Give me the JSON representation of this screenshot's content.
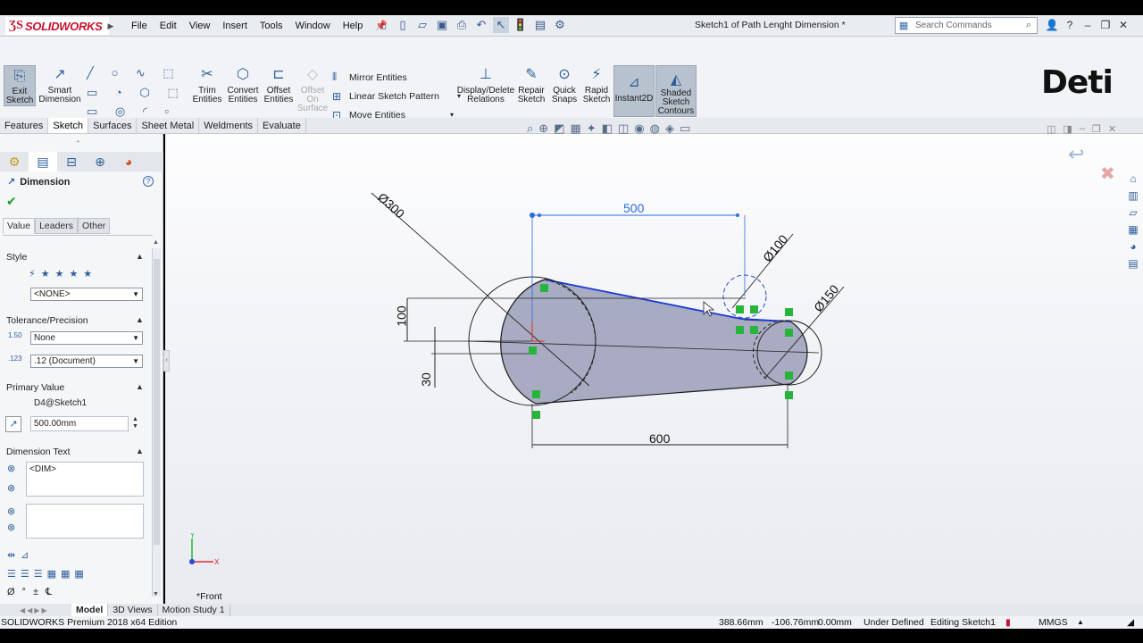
{
  "app": {
    "brand": "SOLIDWORKS",
    "doc_title": "Sketch1 of Path Lenght Dimension *"
  },
  "menu": [
    "File",
    "Edit",
    "View",
    "Insert",
    "Tools",
    "Window",
    "Help"
  ],
  "search": {
    "placeholder": "Search Commands"
  },
  "ribbon": {
    "exit_sketch": "Exit\nSketch",
    "smart_dimension": "Smart\nDimension",
    "trim": "Trim\nEntities",
    "convert": "Convert\nEntities",
    "offset": "Offset\nEntities",
    "offset_surface": "Offset\nOn\nSurface",
    "mirror": "Mirror Entities",
    "linear_pattern": "Linear Sketch Pattern",
    "move": "Move Entities",
    "display_relations": "Display/Delete\nRelations",
    "repair": "Repair\nSketch",
    "quick_snaps": "Quick\nSnaps",
    "rapid": "Rapid\nSketch",
    "instant2d": "Instant2D",
    "shaded": "Shaded\nSketch\nContours"
  },
  "brand_logo": {
    "text": "Deti"
  },
  "command_tabs": [
    "Features",
    "Sketch",
    "Surfaces",
    "Sheet Metal",
    "Weldments",
    "Evaluate"
  ],
  "property_manager": {
    "title": "Dimension",
    "subtabs": [
      "Value",
      "Leaders",
      "Other"
    ],
    "style_label": "Style",
    "style_value": "<NONE>",
    "tolerance_label": "Tolerance/Precision",
    "tolerance_value": "None",
    "precision_value": ".12 (Document)",
    "primary_label": "Primary Value",
    "primary_name": "D4@Sketch1",
    "primary_value": "500.00mm",
    "dim_text_label": "Dimension Text",
    "dim_text_value": "<DIM>"
  },
  "sketch": {
    "dim_500": "500",
    "dim_600": "600",
    "dim_100_vert": "100",
    "dim_30": "30",
    "dia_300": "Ø300",
    "dia_100": "Ø100",
    "dia_150": "Ø150",
    "view_label": "*Front"
  },
  "bottom_tabs": [
    "Model",
    "3D Views",
    "Motion Study 1"
  ],
  "status": {
    "edition": "SOLIDWORKS Premium 2018 x64 Edition",
    "x": "388.66mm",
    "y": "-106.76mm",
    "z": "0.00mm",
    "state": "Under Defined",
    "editing": "Editing Sketch1",
    "units": "MMGS"
  }
}
